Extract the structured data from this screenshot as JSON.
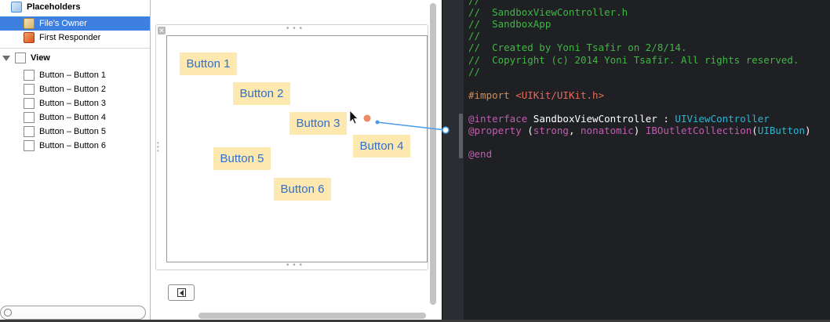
{
  "outline": {
    "placeholders_label": "Placeholders",
    "items": [
      {
        "label": "File's Owner",
        "selected": true,
        "icon": "files-owner-icon"
      },
      {
        "label": "First Responder",
        "selected": false,
        "icon": "first-responder-icon"
      }
    ],
    "view_label": "View",
    "buttons": [
      "Button – Button 1",
      "Button – Button 2",
      "Button – Button 3",
      "Button – Button 4",
      "Button – Button 5",
      "Button – Button 6"
    ]
  },
  "canvas": {
    "buttons": [
      "Button 1",
      "Button 2",
      "Button 3",
      "Button 4",
      "Button 5",
      "Button 6"
    ],
    "close_glyph": "✕",
    "grip_glyph": "• • •"
  },
  "editor": {
    "lines": [
      [
        {
          "t": "//",
          "c": "c-comment"
        }
      ],
      [
        {
          "t": "//  SandboxViewController.h",
          "c": "c-comment"
        }
      ],
      [
        {
          "t": "//  SandboxApp",
          "c": "c-comment"
        }
      ],
      [
        {
          "t": "//",
          "c": "c-comment"
        }
      ],
      [
        {
          "t": "//  Created by Yoni Tsafir on 2/8/14.",
          "c": "c-comment"
        }
      ],
      [
        {
          "t": "//  Copyright (c) 2014 Yoni Tsafir. All rights reserved.",
          "c": "c-comment"
        }
      ],
      [
        {
          "t": "//",
          "c": "c-comment"
        }
      ],
      [],
      [
        {
          "t": "#import ",
          "c": "c-prep"
        },
        {
          "t": "<UIKit/UIKit.h>",
          "c": "c-include"
        }
      ],
      [],
      [
        {
          "t": "@interface",
          "c": "c-kw"
        },
        {
          "t": " SandboxViewController : ",
          "c": "c-plain"
        },
        {
          "t": "UIViewController",
          "c": "c-type"
        }
      ],
      [
        {
          "t": "@property",
          "c": "c-kw"
        },
        {
          "t": " (",
          "c": "c-plain"
        },
        {
          "t": "strong",
          "c": "c-kw"
        },
        {
          "t": ", ",
          "c": "c-plain"
        },
        {
          "t": "nonatomic",
          "c": "c-kw"
        },
        {
          "t": ") ",
          "c": "c-plain"
        },
        {
          "t": "IBOutletCollection",
          "c": "c-kw"
        },
        {
          "t": "(",
          "c": "c-plain"
        },
        {
          "t": "UIButton",
          "c": "c-type"
        },
        {
          "t": ")",
          "c": "c-plain"
        }
      ],
      [],
      [
        {
          "t": "@end",
          "c": "c-kw"
        }
      ]
    ]
  },
  "colors": {
    "selection": "#3d80df",
    "button_fill": "#fde9b0",
    "button_text": "#2f6fd2",
    "connection_line": "#4a9be8",
    "drag_dot": "#ee8a63",
    "editor_bg": "#1e2023"
  }
}
